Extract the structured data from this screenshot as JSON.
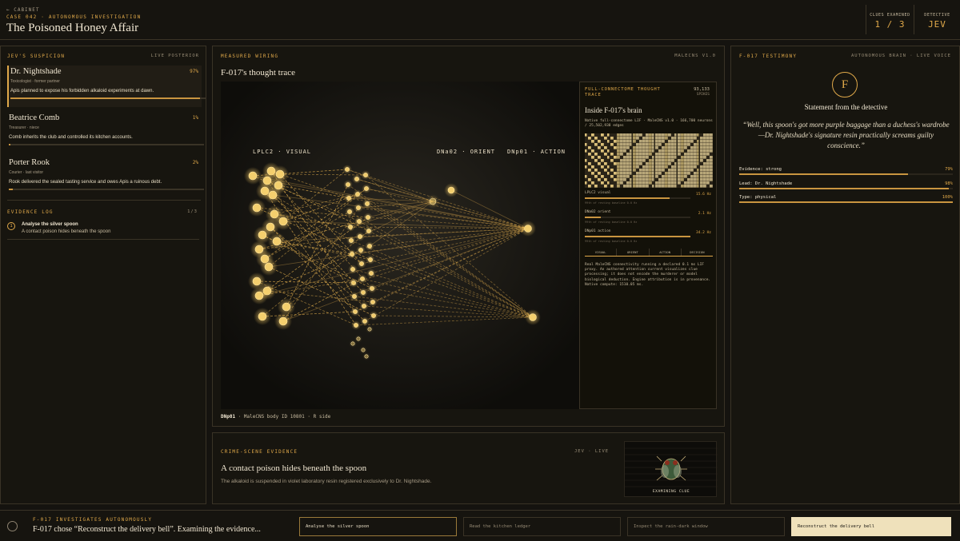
{
  "header": {
    "back": "← CABINET",
    "case": "CASE 042 · AUTONOMOUS INVESTIGATION",
    "title": "The Poisoned Honey Affair",
    "clues_label": "CLUES EXAMINED",
    "clues_value": "1 / 3",
    "detective_label": "DETECTIVE",
    "detective_value": "JEV"
  },
  "suspicion": {
    "label": "JEV'S SUSPICION",
    "right": "LIVE POSTERIOR",
    "suspects": [
      {
        "name": "Dr. Nightshade",
        "role": "Toxicologist · former partner",
        "pct": "97%",
        "value": 0.97,
        "desc": "Apis planned to expose his forbidden alkaloid experiments at dawn."
      },
      {
        "name": "Beatrice Comb",
        "role": "Treasurer · niece",
        "pct": "1%",
        "value": 0.01,
        "desc": "Comb inherits the club and controlled its kitchen accounts."
      },
      {
        "name": "Porter Rook",
        "role": "Courier · last visitor",
        "pct": "2%",
        "value": 0.02,
        "desc": "Rook delivered the sealed tasting service and owes Apis a ruinous debt."
      }
    ]
  },
  "log": {
    "label": "EVIDENCE LOG",
    "count": "1/3",
    "item_num": "1",
    "item_title": "Analyse the silver spoon",
    "item_sub": "A contact poison hides beneath the spoon"
  },
  "wiring": {
    "label": "MEASURED WIRING",
    "right": "MALECNS V1.0",
    "title": "F-017's thought trace",
    "col_visual": "LPLC2 · VISUAL",
    "col_orient": "DNa02 · ORIENT",
    "col_action": "DNp01 · ACTION",
    "footer_bold": "DNp01",
    "footer_text": " · MaleCNS body ID 10801 · R side"
  },
  "trace": {
    "label": "FULL-CONNECTOME THOUGHT TRACE",
    "spikes": "93,133",
    "spikes_label": "SPIKES",
    "title": "Inside F-017's brain",
    "desc": "Native full-connectome LIF · MaleCNS v1.0 · 166,700 neurons / 25,502,938 edges",
    "rows": [
      {
        "label": "LPLC2 visual",
        "value": "15.6 Hz",
        "fill": 0.8,
        "sub": "99th of resting baseline 0.0 Hz"
      },
      {
        "label": "DNa02 orient",
        "value": "2.1 Hz",
        "fill": 0.15,
        "sub": "99th of resting baseline 0.0 Hz"
      },
      {
        "label": "DNp01 action",
        "value": "34.2 Hz",
        "fill": 1.0,
        "sub": "99th of resting baseline 0.0 Hz"
      }
    ],
    "tabs": [
      "VISUAL",
      "ORIENT",
      "ACTION",
      "DECISION"
    ],
    "note": "Real MaleCNS connectivity running a declared 0.1 ms LIF proxy. An authored attention current visualizes clue processing; it does not encode the murderer or model biological deduction. Engine attribution is in provenance. Native compute: 1510.05 ms."
  },
  "evidence": {
    "label": "CRIME-SCENE EVIDENCE",
    "right": "JEV · LIVE",
    "title": "A contact poison hides beneath the spoon",
    "text": "The alkaloid is suspended in violet laboratory resin registered exclusively to Dr. Nightshade.",
    "caption": "EXAMINING CLUE"
  },
  "testimony": {
    "label": "F-017 TESTIMONY",
    "right": "AUTONOMOUS BRAIN · LIVE VOICE",
    "badge": "F",
    "heading": "Statement from the detective",
    "quote": "“Well, this spoon's got more purple baggage than a duchess's wardrobe—Dr. Nightshade's signature resin practically screams guilty conscience.”",
    "stats": [
      {
        "label": "Evidence: strong",
        "value": "79%",
        "fill": 0.79
      },
      {
        "label": "Lead: Dr. Nightshade",
        "value": "98%",
        "fill": 0.98
      },
      {
        "label": "Type: physical",
        "value": "100%",
        "fill": 1.0
      }
    ]
  },
  "footer": {
    "label": "F-017 INVESTIGATES AUTONOMOUSLY",
    "status": "F-017 chose “Reconstruct the delivery bell”. Examining the evidence...",
    "actions": [
      "Analyse the silver spoon",
      "Read the kitchen ledger",
      "Inspect the rain-dark window",
      "Reconstruct the delivery bell"
    ]
  },
  "colors": {
    "accent": "#e0a94a",
    "background": "#15130f",
    "text": "#e8ddc4"
  }
}
